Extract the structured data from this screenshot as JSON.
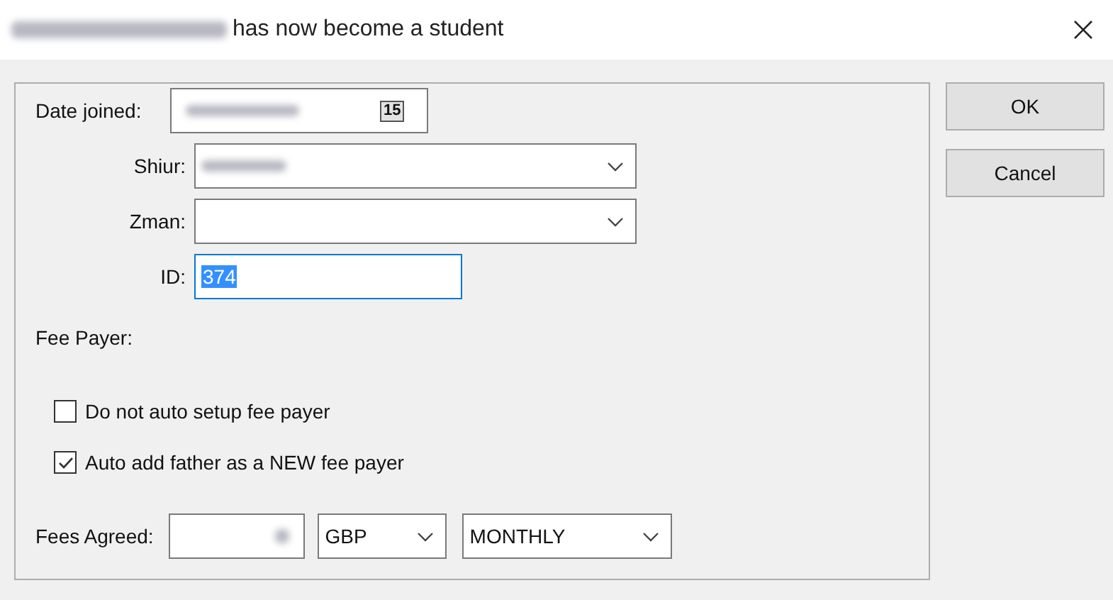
{
  "window": {
    "title": "has now become a student",
    "title_redacted": true
  },
  "form": {
    "date_joined": {
      "label": "Date joined:",
      "redacted": true,
      "calendar_button": "15"
    },
    "shiur": {
      "label": "Shiur:",
      "redacted": true
    },
    "zman": {
      "label": "Zman:"
    },
    "id": {
      "label": "ID:",
      "value": "374",
      "selected_text": true
    },
    "fee_payer": {
      "label": "Fee Payer:"
    },
    "checkboxes": [
      {
        "label": "Do not auto setup fee payer",
        "checked": false
      },
      {
        "label": "Auto add father as a NEW fee payer",
        "checked": true
      }
    ],
    "fees_agreed": {
      "label": "Fees Agreed:",
      "redacted": true,
      "currency": "GBP",
      "frequency": "MONTHLY"
    }
  },
  "buttons": [
    "OK",
    "Cancel"
  ]
}
